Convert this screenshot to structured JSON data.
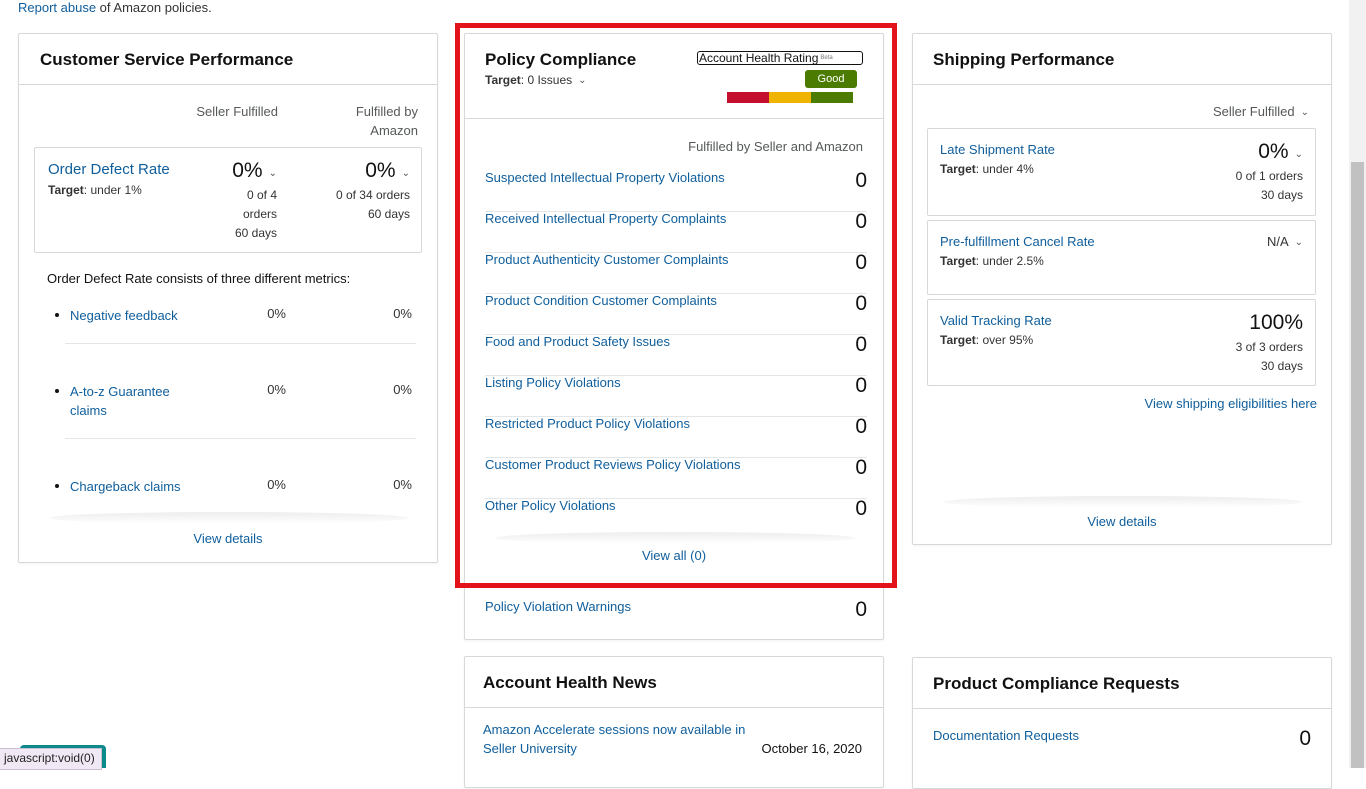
{
  "top_note": {
    "link": "Report abuse",
    "rest": " of Amazon policies."
  },
  "csp": {
    "title": "Customer Service Performance",
    "col_seller": "Seller Fulfilled",
    "col_amazon_l1": "Fulfilled by",
    "col_amazon_l2": "Amazon",
    "odr": {
      "label": "Order Defect Rate",
      "target_prefix": "Target",
      "target_value": ": under 1%",
      "seller_value": "0%",
      "seller_l1": "0 of 4",
      "seller_l2": "orders",
      "seller_l3": "60 days",
      "amazon_value": "0%",
      "amazon_l1": "0 of 34 orders",
      "amazon_l2": "60 days"
    },
    "consists_text": "Order Defect Rate consists of three different metrics:",
    "metrics": [
      {
        "l1": "Negative feedback",
        "l2": "",
        "seller": "0%",
        "amazon": "0%"
      },
      {
        "l1": "A-to-z Guarantee",
        "l2": "claims",
        "seller": "0%",
        "amazon": "0%"
      },
      {
        "l1": "Chargeback claims",
        "l2": "",
        "seller": "0%",
        "amazon": "0%"
      }
    ],
    "view_details": "View details"
  },
  "pc": {
    "title": "Policy Compliance",
    "target_prefix": "Target",
    "target_value": ": 0 Issues",
    "ahr_label": "Account Health Rating",
    "ahr_beta": "Beta",
    "badge": "Good",
    "bar_colors": [
      "#c40f2e",
      "#f0b400",
      "#4b7b00"
    ],
    "col_head": "Fulfilled by Seller and Amazon",
    "rows": [
      {
        "label": "Suspected Intellectual Property Violations",
        "count": "0"
      },
      {
        "label": "Received Intellectual Property Complaints",
        "count": "0"
      },
      {
        "label": "Product Authenticity Customer Complaints",
        "count": "0"
      },
      {
        "label": "Product Condition Customer Complaints",
        "count": "0"
      },
      {
        "label": "Food and Product Safety Issues",
        "count": "0"
      },
      {
        "label": "Listing Policy Violations",
        "count": "0"
      },
      {
        "label": "Restricted Product Policy Violations",
        "count": "0"
      },
      {
        "label": "Customer Product Reviews Policy Violations",
        "count": "0"
      },
      {
        "label": "Other Policy Violations",
        "count": "0"
      }
    ],
    "view_all": "View all (0)",
    "warnings": {
      "label": "Policy Violation Warnings",
      "count": "0"
    }
  },
  "sp": {
    "title": "Shipping Performance",
    "filter": "Seller Fulfilled",
    "boxes": [
      {
        "label": "Late Shipment Rate",
        "target_prefix": "Target",
        "target_value": ": under 4%",
        "value": "0%",
        "l1": "0 of 1 orders",
        "l2": "30 days"
      },
      {
        "label": "Pre-fulfillment Cancel Rate",
        "target_prefix": "Target",
        "target_value": ": under 2.5%",
        "value": "N/A",
        "l1": "",
        "l2": ""
      },
      {
        "label": "Valid Tracking Rate",
        "target_prefix": "Target",
        "target_value": ": over 95%",
        "value": "100%",
        "l1": "3 of 3 orders",
        "l2": "30 days"
      }
    ],
    "eligibilities": "View shipping eligibilities here",
    "view_details": "View details"
  },
  "ahn": {
    "title": "Account Health News",
    "item_l1": "Amazon Accelerate sessions now available in",
    "item_l2": "Seller University",
    "item_date": "October 16, 2020"
  },
  "pcr": {
    "title": "Product Compliance Requests",
    "row_label": "Documentation Requests",
    "row_count": "0"
  },
  "statusbar": "javascript:void(0)"
}
